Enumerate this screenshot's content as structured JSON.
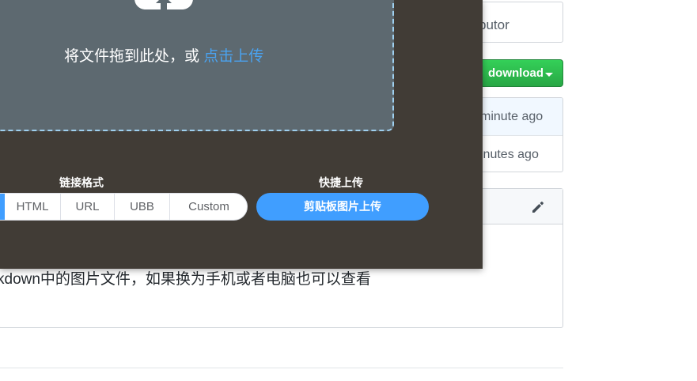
{
  "sidebar": {
    "contributors_text": "butor",
    "download_label": "download",
    "commits": [
      {
        "time": "minute ago"
      },
      {
        "time": "inutes ago"
      }
    ]
  },
  "readme": {
    "text": "kdown中的图片文件，如果换为手机或者电脑也可以查看"
  },
  "upload_modal": {
    "drop_text": "将文件拖到此处，或 ",
    "drop_link": "点击上传",
    "link_format_label": "链接格式",
    "formats": [
      "HTML",
      "URL",
      "UBB",
      "Custom"
    ],
    "quick_upload_label": "快捷上传",
    "clipboard_button": "剪贴板图片上传"
  },
  "colors": {
    "modal_bg": "#413c36",
    "drop_zone_bg": "#5d6970",
    "accent_blue": "#409eff",
    "download_green": "#28a745"
  },
  "icons": {
    "upload": "cloud-upload-icon",
    "edit": "pencil-icon",
    "dropdown": "caret-down-icon"
  }
}
